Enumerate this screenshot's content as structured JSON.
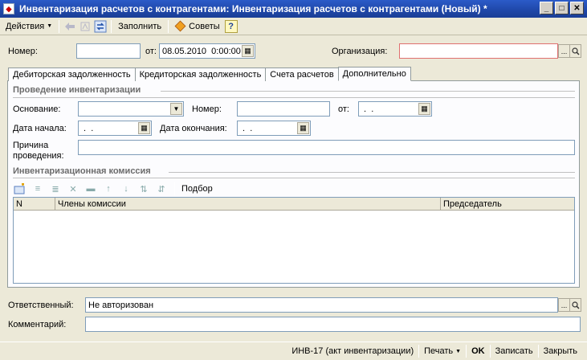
{
  "window": {
    "title": "Инвентаризация расчетов с контрагентами: Инвентаризация расчетов с контрагентами (Новый) *",
    "minimize_label": "_",
    "maximize_label": "□",
    "close_label": "✕"
  },
  "toolbar": {
    "actions_label": "Действия",
    "fill_label": "Заполнить",
    "tips_label": "Советы",
    "help_label": "?"
  },
  "header": {
    "number_label": "Номер:",
    "number_value": "",
    "date_from_label": "от:",
    "date_value": "08.05.2010  0:00:00",
    "organization_label": "Организация:",
    "organization_value": ""
  },
  "tabs": [
    {
      "label": "Дебиторская задолженность",
      "active": false
    },
    {
      "label": "Кредиторская задолженность",
      "active": false
    },
    {
      "label": "Счета расчетов",
      "active": false
    },
    {
      "label": "Дополнительно",
      "active": true
    }
  ],
  "inventory": {
    "section_title": "Проведение инвентаризации",
    "basis_label": "Основание:",
    "basis_value": "",
    "number_label": "Номер:",
    "number_value": "",
    "from_label": "от:",
    "from_value": " .  .",
    "start_date_label": "Дата начала:",
    "start_date_value": " .  .",
    "end_date_label": "Дата окончания:",
    "end_date_value": " .  .",
    "reason_label_1": "Причина",
    "reason_label_2": "проведения:",
    "reason_value": ""
  },
  "commission": {
    "section_title": "Инвентаризационная комиссия",
    "pick_label": "Подбор",
    "columns": [
      "N",
      "Члены комиссии",
      "Председатель"
    ],
    "rows": []
  },
  "footer": {
    "responsible_label": "Ответственный:",
    "responsible_value": "Не авторизован",
    "comment_label": "Комментарий:",
    "comment_value": ""
  },
  "statusbar": {
    "report_label": "ИНВ-17 (акт инвентаризации)",
    "print_label": "Печать",
    "ok_label": "OK",
    "save_label": "Записать",
    "close_label": "Закрыть"
  },
  "colors": {
    "titlebar": "#1f47a8",
    "window_bg": "#ece9d8",
    "field_border": "#7f9db9",
    "section_text": "#6b6b6b"
  }
}
